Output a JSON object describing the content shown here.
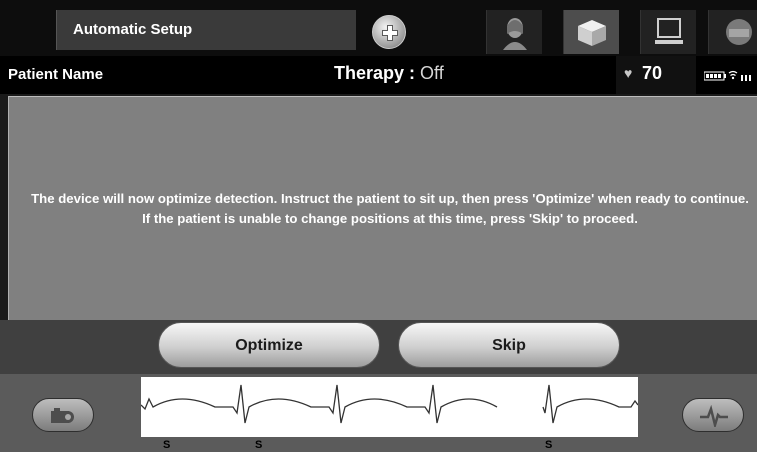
{
  "header": {
    "title": "Automatic Setup",
    "tabs": [
      {
        "icon": "patient-portrait-icon"
      },
      {
        "icon": "device-box-icon",
        "active": true
      },
      {
        "icon": "monitor-icon"
      },
      {
        "icon": "programmer-wand-icon"
      }
    ],
    "add_icon": "plus-circle-icon"
  },
  "patient_bar": {
    "patient_name": "Patient Name",
    "therapy_label": "Therapy :",
    "therapy_value": "Off",
    "heart_rate": "70"
  },
  "message": "The device will now optimize detection. Instruct the patient to sit up, then press 'Optimize' when ready to continue. If the patient is unable to change positions at this time, press 'Skip' to proceed.",
  "actions": {
    "optimize_label": "Optimize",
    "skip_label": "Skip"
  },
  "ecg": {
    "markers": [
      "S",
      "S",
      "S"
    ]
  }
}
